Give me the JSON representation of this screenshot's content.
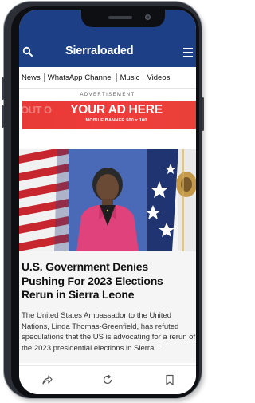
{
  "header": {
    "logo_text": "Sierraloaded",
    "background": "#1d3f86",
    "search_icon": "search-icon",
    "menu_icon": "hamburger-menu-icon"
  },
  "nav": {
    "items": [
      "News",
      "WhatsApp Channel",
      "Music",
      "Videos"
    ]
  },
  "ad": {
    "label": "ADVERTISEMENT",
    "ghost_text": "OUT O",
    "title": "YOUR AD HERE",
    "subtitle": "MOBILE BANNER 500 x 100",
    "color": "#ef3c3a"
  },
  "article": {
    "headline": "U.S. Government Denies Pushing For 2023 Elections Rerun in Sierra Leone",
    "excerpt": "The United States Ambassador to the United Nations, Linda Thomas-Greenfield, has refuted speculations that the US is advocating for a rerun of the 2023 presidential elections in Sierra..."
  },
  "bottom_bar": {
    "icons": [
      "share-icon",
      "refresh-icon",
      "bookmark-icon"
    ]
  }
}
